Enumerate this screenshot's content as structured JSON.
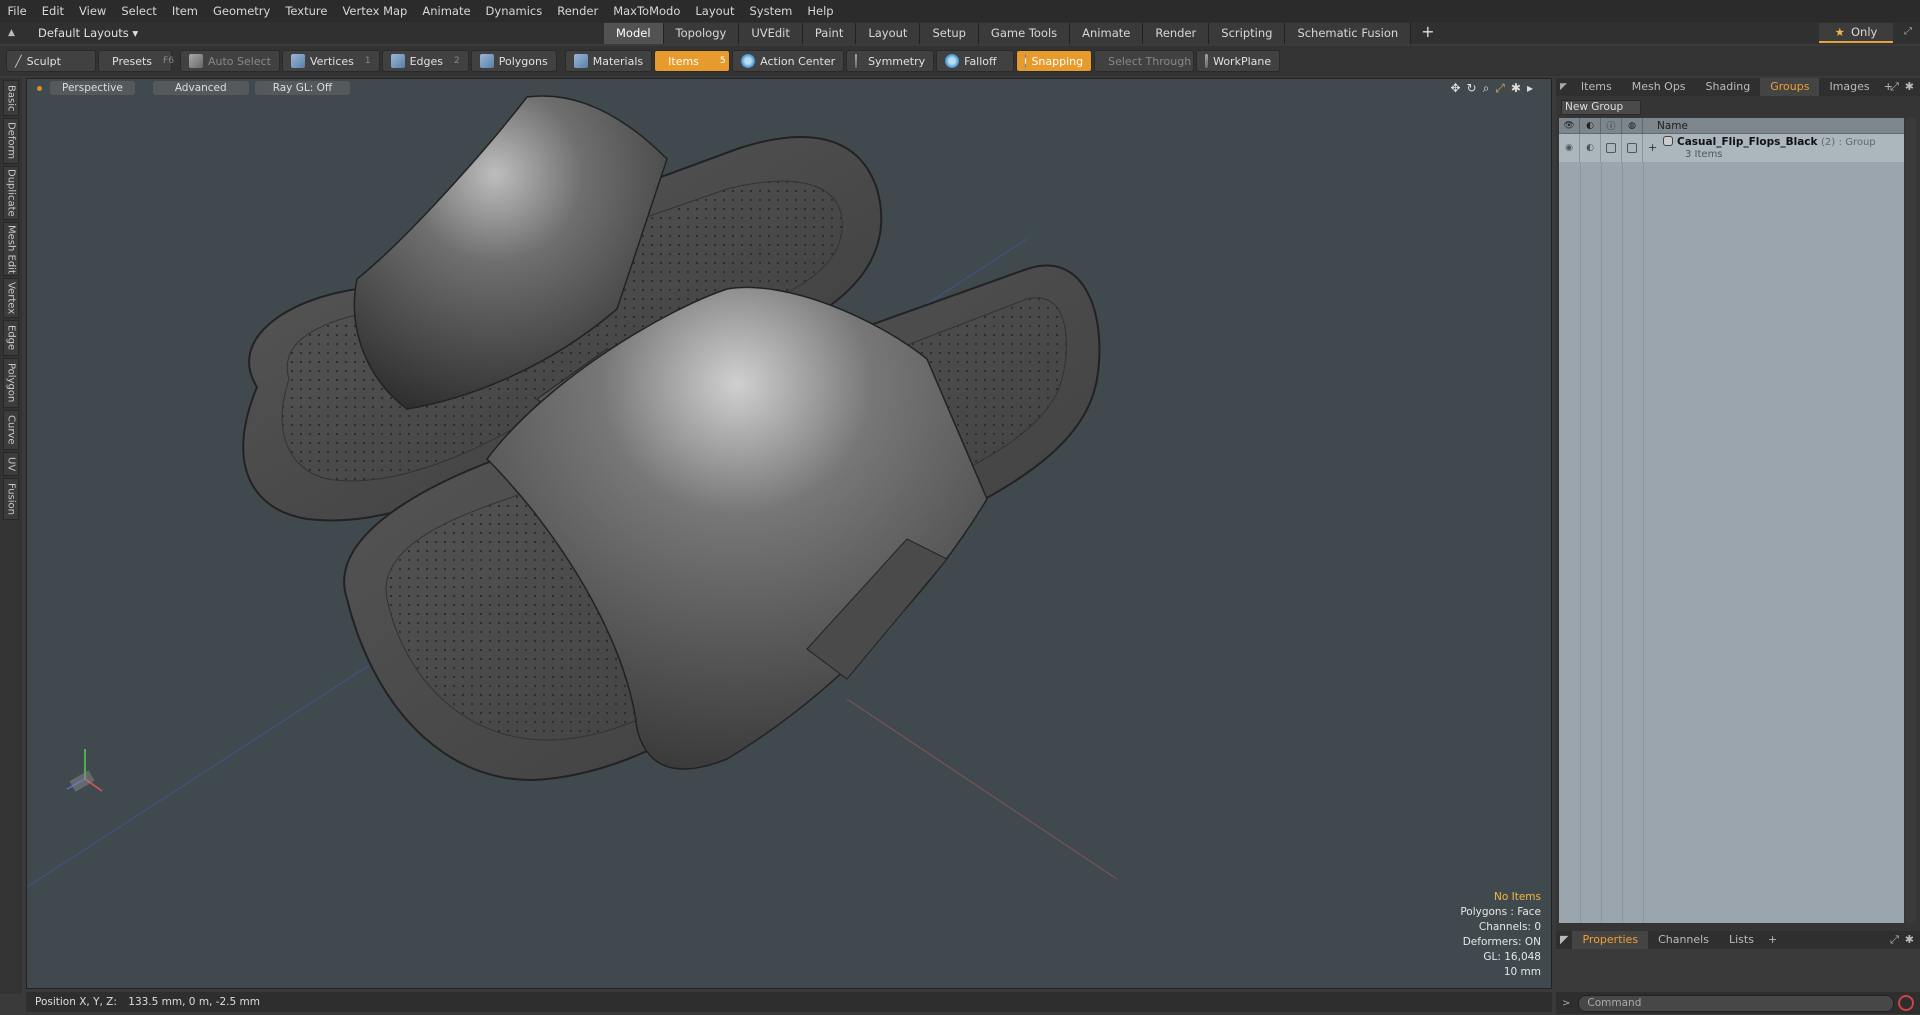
{
  "menu": [
    "File",
    "Edit",
    "View",
    "Select",
    "Item",
    "Geometry",
    "Texture",
    "Vertex Map",
    "Animate",
    "Dynamics",
    "Render",
    "MaxToModo",
    "Layout",
    "System",
    "Help"
  ],
  "layout_dropdown": "Default Layouts ▾",
  "tabs": [
    "Model",
    "Topology",
    "UVEdit",
    "Paint",
    "Layout",
    "Setup",
    "Game Tools",
    "Animate",
    "Render",
    "Scripting",
    "Schematic Fusion"
  ],
  "active_tab": "Model",
  "only_label": "Only",
  "toolbar": {
    "sculpt": "Sculpt",
    "presets": "Presets",
    "presets_key": "F6",
    "auto_select": "Auto Select",
    "vertices": "Vertices",
    "vertices_key": "1",
    "edges": "Edges",
    "edges_key": "2",
    "polygons": "Polygons",
    "materials": "Materials",
    "items": "Items",
    "items_key": "5",
    "action_center": "Action Center",
    "symmetry": "Symmetry",
    "falloff": "Falloff",
    "snapping": "Snapping",
    "select_through": "Select Through",
    "workplane": "WorkPlane"
  },
  "left_tabs": [
    "Basic",
    "Deform",
    "Duplicate",
    "Mesh Edit",
    "Vertex",
    "Edge",
    "Polygon",
    "Curve",
    "UV",
    "Fusion"
  ],
  "viewport": {
    "view": "Perspective",
    "shading": "Advanced",
    "raygl": "Ray GL: Off",
    "info": {
      "selection": "No Items",
      "polygons": "Polygons : Face",
      "channels": "Channels: 0",
      "deformers": "Deformers: ON",
      "gl": "GL: 16,048",
      "grid": "10 mm"
    }
  },
  "right_panel": {
    "tabs": [
      "Items",
      "Mesh Ops",
      "Shading",
      "Groups",
      "Images"
    ],
    "active_tab": "Groups",
    "new_group": "New Group",
    "name_header": "Name",
    "group": {
      "name": "Casual_Flip_Flops_Black",
      "count": "(2)",
      "type": ": Group",
      "sub": "3 Items"
    },
    "bottom_tabs": [
      "Properties",
      "Channels",
      "Lists"
    ],
    "bottom_active": "Properties"
  },
  "status": {
    "position_label": "Position X, Y, Z:",
    "position_value": "133.5 mm, 0 m, -2.5 mm"
  },
  "command_placeholder": "Command",
  "colors": {
    "accent": "#e79b2c",
    "viewport_bg": "#404a4e",
    "group_table_bg": "#9aa5ad"
  }
}
